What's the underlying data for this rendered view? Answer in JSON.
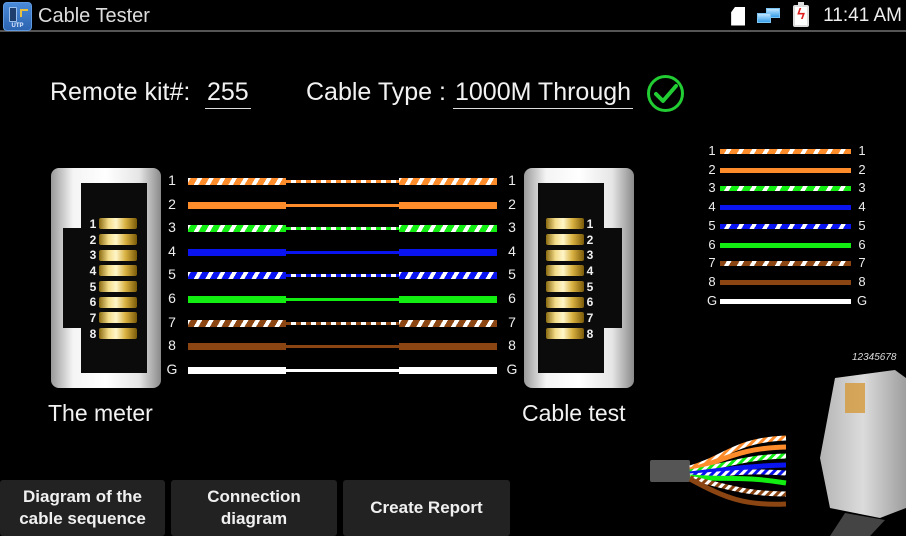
{
  "app": {
    "title": "Cable Tester",
    "icon_text": "UTP"
  },
  "status_bar": {
    "time": "11:41 AM",
    "icons": [
      "sd-card-icon",
      "network-icon",
      "battery-charging-icon"
    ]
  },
  "header": {
    "remote_kit_label": "Remote kit#:",
    "remote_kit_value": "255",
    "cable_type_label": "Cable Type :",
    "cable_type_value": "1000M Through",
    "result_status": "pass"
  },
  "wire_map": {
    "left_connector_caption": "The meter",
    "right_connector_caption": "Cable test",
    "connector_pins": [
      "1",
      "2",
      "3",
      "4",
      "5",
      "6",
      "7",
      "8"
    ],
    "wires": [
      {
        "left": "1",
        "right": "1",
        "color": "#ff8c2a",
        "striped": true,
        "connected": true
      },
      {
        "left": "2",
        "right": "2",
        "color": "#ff8c2a",
        "striped": false,
        "connected": true
      },
      {
        "left": "3",
        "right": "3",
        "color": "#12ee12",
        "striped": true,
        "connected": true
      },
      {
        "left": "4",
        "right": "4",
        "color": "#0a14f0",
        "striped": false,
        "connected": true
      },
      {
        "left": "5",
        "right": "5",
        "color": "#0a14f0",
        "striped": true,
        "connected": true
      },
      {
        "left": "6",
        "right": "6",
        "color": "#12ee12",
        "striped": false,
        "connected": true
      },
      {
        "left": "7",
        "right": "7",
        "color": "#8b4512",
        "striped": true,
        "connected": true
      },
      {
        "left": "8",
        "right": "8",
        "color": "#8b4512",
        "striped": false,
        "connected": true
      },
      {
        "left": "G",
        "right": "G",
        "color": "#ffffff",
        "striped": false,
        "connected": true
      }
    ]
  },
  "legend": {
    "rows": [
      {
        "left": "1",
        "right": "1",
        "color": "#ff8c2a",
        "striped": true
      },
      {
        "left": "2",
        "right": "2",
        "color": "#ff8c2a",
        "striped": false
      },
      {
        "left": "3",
        "right": "3",
        "color": "#12ee12",
        "striped": true
      },
      {
        "left": "4",
        "right": "4",
        "color": "#0a14f0",
        "striped": false
      },
      {
        "left": "5",
        "right": "5",
        "color": "#0a14f0",
        "striped": true
      },
      {
        "left": "6",
        "right": "6",
        "color": "#12ee12",
        "striped": false
      },
      {
        "left": "7",
        "right": "7",
        "color": "#8b4512",
        "striped": true
      },
      {
        "left": "8",
        "right": "8",
        "color": "#8b4512",
        "striped": false
      },
      {
        "left": "G",
        "right": "G",
        "color": "#ffffff",
        "striped": false
      }
    ]
  },
  "illustration": {
    "pin_order_text": "12345678"
  },
  "buttons": [
    {
      "label_line1": "Diagram of the",
      "label_line2": "cable sequence"
    },
    {
      "label_line1": "Connection",
      "label_line2": "diagram"
    },
    {
      "label_line1": "Create Report",
      "label_line2": ""
    }
  ]
}
